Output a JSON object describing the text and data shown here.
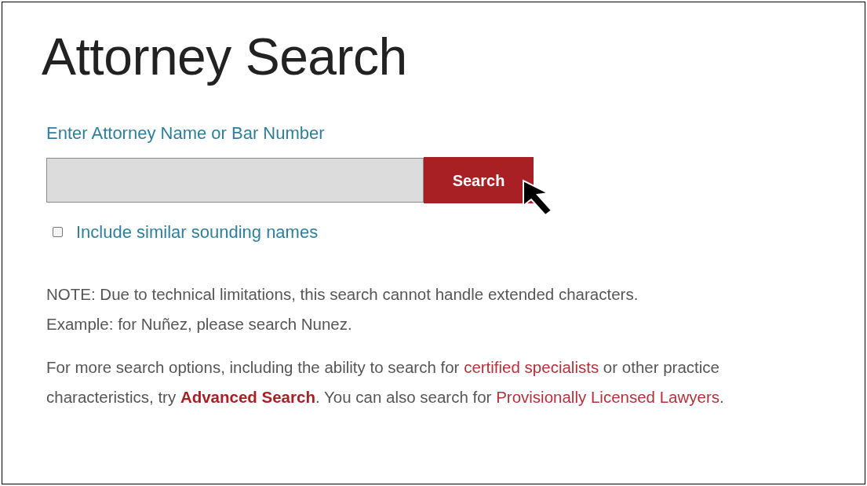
{
  "title": "Attorney Search",
  "search": {
    "label": "Enter Attorney Name or Bar Number",
    "button": "Search"
  },
  "similar_names": {
    "label": "Include similar sounding names",
    "checked": false
  },
  "note": {
    "lines": [
      "NOTE: Due to technical limitations, this search cannot handle extended characters.",
      "Example: for Nuñez, please search Nunez."
    ]
  },
  "more_options": [
    {
      "kind": "text",
      "text": "For more search options, including the ability to search for "
    },
    {
      "kind": "link",
      "text": "certified specialists"
    },
    {
      "kind": "text",
      "text": " or other practice characteristics, try "
    },
    {
      "kind": "bold_link",
      "text": "Advanced Search"
    },
    {
      "kind": "text",
      "text": ". You can also search for "
    },
    {
      "kind": "link",
      "text": "Provisionally Licensed Lawyers"
    },
    {
      "kind": "text",
      "text": "."
    }
  ]
}
